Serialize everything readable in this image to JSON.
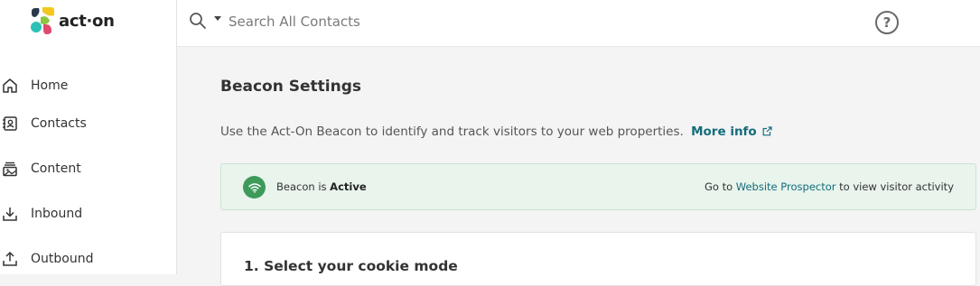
{
  "app": {
    "logo_text": "act·on",
    "brand_colors": [
      "#f2c81f",
      "#8dc63f",
      "#e04a6d",
      "#2cc1b5"
    ]
  },
  "sidebar": {
    "items": [
      {
        "label": "Home",
        "icon": "home-icon"
      },
      {
        "label": "Contacts",
        "icon": "contacts-icon"
      },
      {
        "label": "Content",
        "icon": "content-icon"
      },
      {
        "label": "Inbound",
        "icon": "inbound-icon"
      },
      {
        "label": "Outbound",
        "icon": "outbound-icon"
      }
    ]
  },
  "topbar": {
    "search_placeholder": "Search All Contacts",
    "search_value": "",
    "search_icon": "search-icon",
    "help_icon": "help-icon",
    "help_glyph": "?"
  },
  "main": {
    "title": "Beacon Settings",
    "description": "Use the Act-On Beacon to identify and track visitors to your web properties.",
    "more_info_label": "More info",
    "status": {
      "prefix": "Beacon is",
      "value": "Active",
      "goto_prefix": "Go to",
      "link_label": "Website Prospector",
      "goto_suffix": "to view visitor activity",
      "color": "#3d9a5b",
      "icon": "wifi-icon"
    },
    "section_title": "1. Select your cookie mode"
  },
  "colors": {
    "accent": "#136c7a",
    "success_bg": "#e8f4ec",
    "page_bg": "#f4f4f4"
  }
}
